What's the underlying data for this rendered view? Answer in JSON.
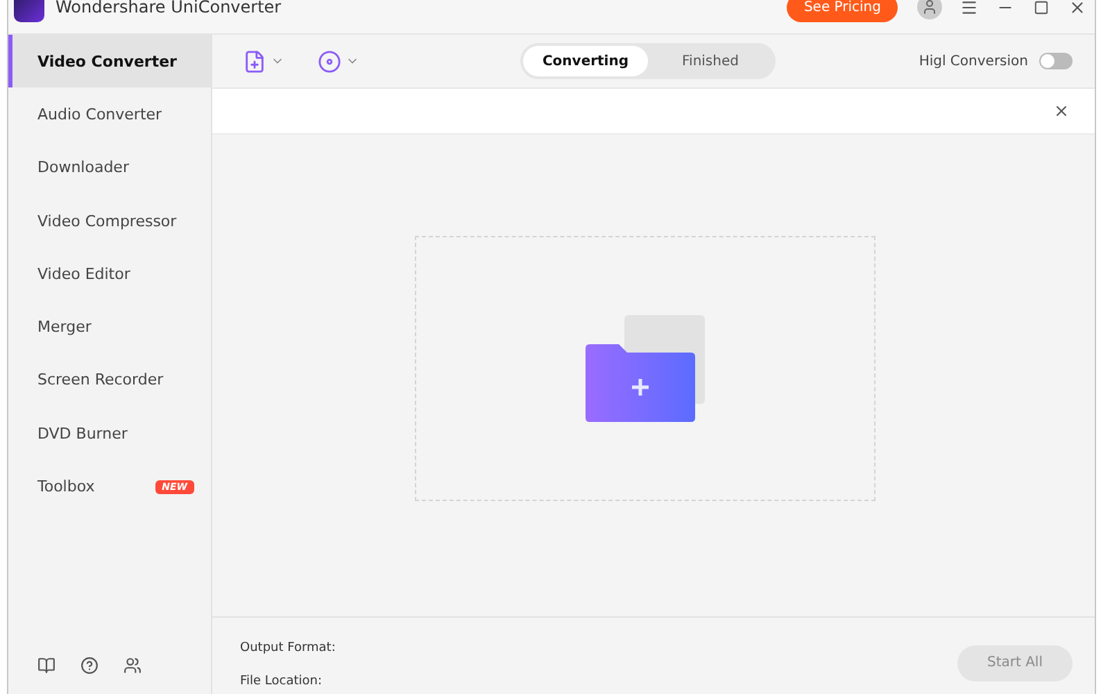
{
  "window": {
    "title": "Wondershare UniConverter",
    "pricing_button": "See Pricing"
  },
  "sidebar": {
    "items": [
      {
        "label": "Video Converter",
        "selected": true
      },
      {
        "label": "Audio Converter",
        "selected": false
      },
      {
        "label": "Downloader",
        "selected": false
      },
      {
        "label": "Video Compressor",
        "selected": false
      },
      {
        "label": "Video Editor",
        "selected": false
      },
      {
        "label": "Merger",
        "selected": false
      },
      {
        "label": "Screen Recorder",
        "selected": false
      },
      {
        "label": "DVD Burner",
        "selected": false
      },
      {
        "label": "Toolbox",
        "selected": false,
        "badge": "NEW"
      }
    ]
  },
  "tabs": [
    {
      "label": "Converting",
      "selected": true
    },
    {
      "label": "Finished",
      "selected": false
    }
  ],
  "high_conversion": {
    "label": "Higl Conversion",
    "on": false
  },
  "footer": {
    "output_format": "Output Format:",
    "file_location": "File Location:",
    "start_button": {
      "label": "Start All",
      "disabled": true
    }
  }
}
